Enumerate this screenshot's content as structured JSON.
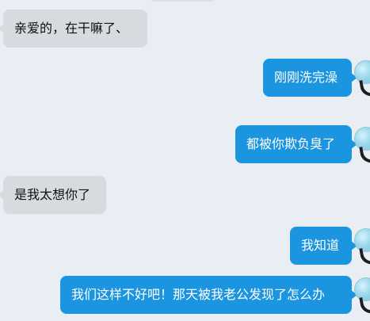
{
  "messages": [
    {
      "from": "other",
      "text": "亲爱的，在干嘛了、"
    },
    {
      "from": "me",
      "text": "刚刚洗完澡"
    },
    {
      "from": "me",
      "text": "都被你欺负臭了"
    },
    {
      "from": "other",
      "text": "是我太想你了"
    },
    {
      "from": "me",
      "text": "我知道"
    },
    {
      "from": "me",
      "text": "我们这样不好吧！那天被我老公发现了怎么办"
    }
  ],
  "colors": {
    "background": "#e9eef4",
    "incoming_bubble": "#d7dbe0",
    "outgoing_bubble": "#1b95e0",
    "outgoing_text": "#ffffff",
    "incoming_text": "#111111"
  },
  "icons": {
    "avatar": "user-avatar-icon"
  }
}
